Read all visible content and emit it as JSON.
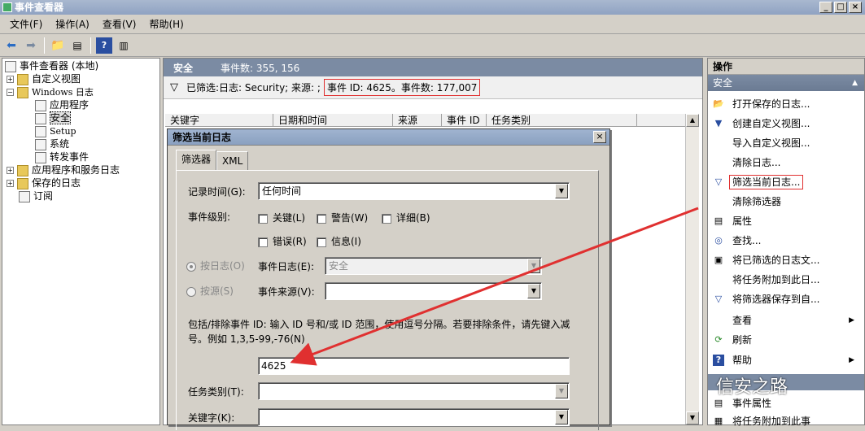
{
  "window": {
    "title": "事件查看器"
  },
  "menu": [
    "文件(F)",
    "操作(A)",
    "查看(V)",
    "帮助(H)"
  ],
  "toolbar": {
    "icons": [
      "back-arrow-icon",
      "forward-arrow-icon",
      "folder-up-icon",
      "console-tree-icon",
      "help-icon",
      "show-pane-icon"
    ]
  },
  "tree": {
    "root": "事件查看器 (本地)",
    "custom_views": "自定义视图",
    "windows_logs": "Windows 日志",
    "application": "应用程序",
    "security": "安全",
    "setup": "Setup",
    "system": "系统",
    "forwarded": "转发事件",
    "app_service_logs": "应用程序和服务日志",
    "saved_logs": "保存的日志",
    "subscriptions": "订阅"
  },
  "center": {
    "title": "安全",
    "event_count": "事件数: 355, 156",
    "filter_prefix": "已筛选:日志: Security; 来源: ;",
    "filter_highlight": "事件 ID: 4625。事件数: 177,007",
    "columns": [
      "关键字",
      "日期和时间",
      "来源",
      "事件 ID",
      "任务类别"
    ]
  },
  "dialog": {
    "title": "筛选当前日志",
    "tab_filter": "筛选器",
    "tab_xml": "XML",
    "logged_label": "记录时间(G):",
    "logged_value": "任何时间",
    "level_label": "事件级别:",
    "level_critical": "关键(L)",
    "level_warning": "警告(W)",
    "level_verbose": "详细(B)",
    "level_error": "错误(R)",
    "level_info": "信息(I)",
    "by_log": "按日志(O)",
    "by_source": "按源(S)",
    "event_logs_label": "事件日志(E):",
    "event_logs_value": "安全",
    "event_sources_label": "事件来源(V):",
    "event_sources_value": "",
    "desc_line1": "包括/排除事件 ID: 输入 ID 号和/或 ID 范围，使用逗号分隔。若要排除条件，请先键入减",
    "desc_line2": "号。例如 1,3,5-99,-76(N)",
    "event_id_value": "4625",
    "task_label": "任务类别(T):",
    "keywords_label": "关键字(K):"
  },
  "actions": {
    "header": "操作",
    "section": "安全",
    "items": [
      {
        "label": "打开保存的日志...",
        "icon": "open-folder-icon"
      },
      {
        "label": "创建自定义视图...",
        "icon": "funnel-icon"
      },
      {
        "label": "导入自定义视图...",
        "icon": ""
      },
      {
        "label": "清除日志...",
        "icon": ""
      },
      {
        "label": "筛选当前日志...",
        "icon": "filter-icon"
      },
      {
        "label": "清除筛选器",
        "icon": ""
      },
      {
        "label": "属性",
        "icon": "properties-icon"
      },
      {
        "label": "查找...",
        "icon": "binoculars-icon"
      },
      {
        "label": "将已筛选的日志文...",
        "icon": "save-icon"
      },
      {
        "label": "将任务附加到此日...",
        "icon": ""
      },
      {
        "label": "将筛选器保存到自...",
        "icon": "filter-save-icon"
      },
      {
        "label": "查看",
        "icon": ""
      },
      {
        "label": "刷新",
        "icon": "refresh-icon"
      },
      {
        "label": "帮助",
        "icon": "help-icon"
      }
    ],
    "lower_items": [
      "事件属性",
      "将任务附加到此事"
    ]
  },
  "watermark": "信安之路",
  "colors": {
    "highlight_red": "#e03030",
    "pane_header": "#7b8ba3"
  }
}
